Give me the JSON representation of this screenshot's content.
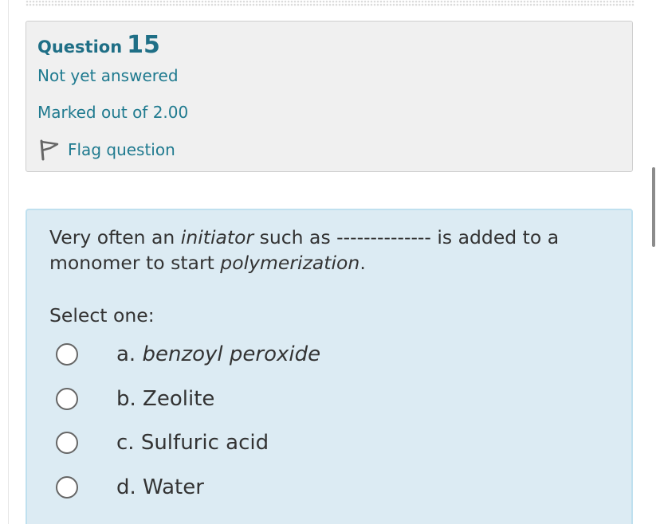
{
  "question": {
    "label": "Question",
    "number": "15",
    "status": "Not yet answered",
    "marked_out_of": "Marked out of 2.00",
    "flag_label": "Flag question",
    "flag_icon": "flag-icon"
  },
  "content": {
    "text_part1": "Very often an ",
    "text_italic1": "initiator",
    "text_part2": " such as -------------- is added to a monomer to start ",
    "text_italic2": "polymerization",
    "text_part3": ".",
    "select_one": "Select one:",
    "options": [
      {
        "letter": "a. ",
        "text": "benzoyl peroxide",
        "italic": true,
        "selected": false
      },
      {
        "letter": "b. ",
        "text": "Zeolite",
        "italic": false,
        "selected": false
      },
      {
        "letter": "c. ",
        "text": "Sulfuric acid",
        "italic": false,
        "selected": false
      },
      {
        "letter": "d. ",
        "text": "Water",
        "italic": false,
        "selected": false
      }
    ]
  },
  "colors": {
    "link": "#1f7a8f",
    "info_bg": "#f0f0f0",
    "content_bg": "#dcebf3",
    "content_border": "#bfe0ef"
  }
}
